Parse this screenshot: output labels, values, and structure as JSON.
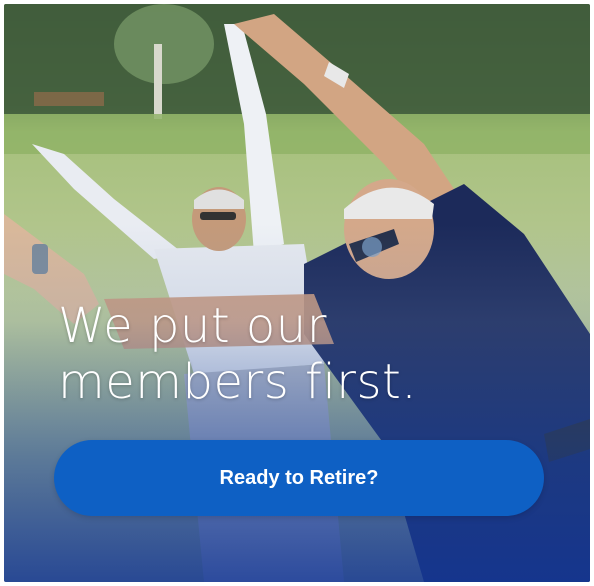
{
  "hero": {
    "image_icon": "seniors-stretching-outdoors-photo",
    "headline_line1": "We put our",
    "headline_line2": "members first.",
    "cta_label": "Ready to Retire?"
  },
  "colors": {
    "cta_background": "#0e60c4",
    "headline_text": "#ffffff",
    "overlay_blue": "#1e46a0"
  }
}
